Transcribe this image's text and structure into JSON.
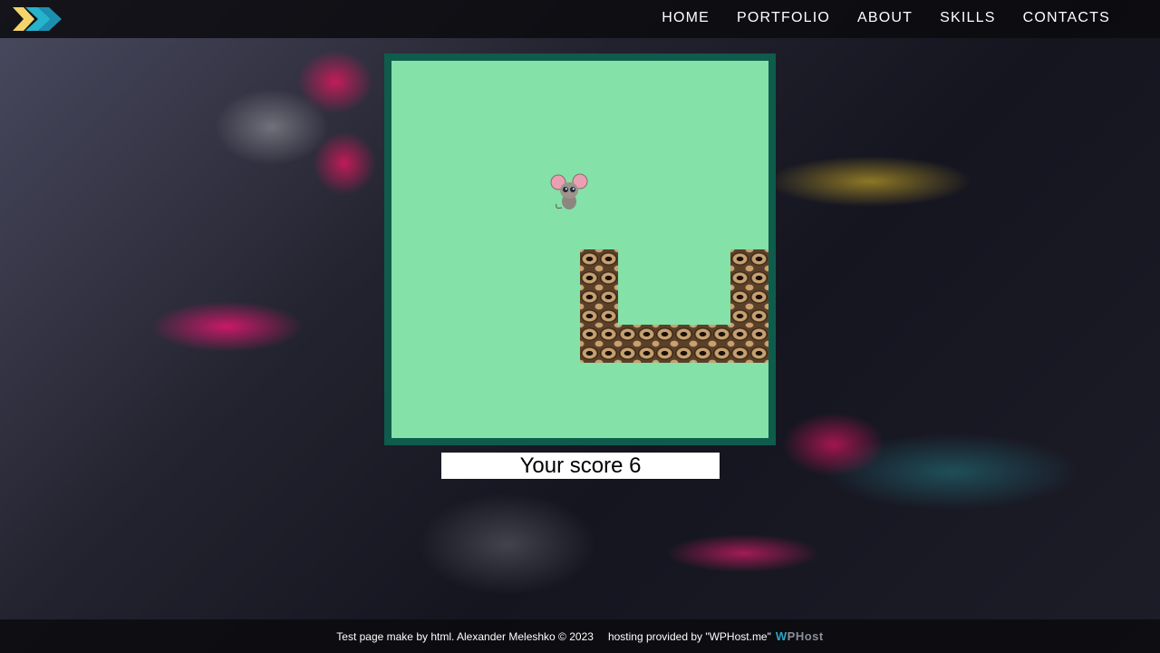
{
  "header": {
    "logo_icon": "double-chevron-right-icon",
    "nav": [
      {
        "label": "HOME"
      },
      {
        "label": "PORTFOLIO"
      },
      {
        "label": "ABOUT"
      },
      {
        "label": "SKILLS"
      },
      {
        "label": "CONTACTS"
      }
    ]
  },
  "game": {
    "score_text": "Your score 6",
    "colors": {
      "board": "#84e1a8",
      "border": "#0e5c4b"
    }
  },
  "footer": {
    "copyright": "Test page make by html. Alexander Meleshko © 2023",
    "hosting": "hosting provided by \"WPHost.me\"",
    "brand_w": "W",
    "brand_rest": "PHost"
  }
}
